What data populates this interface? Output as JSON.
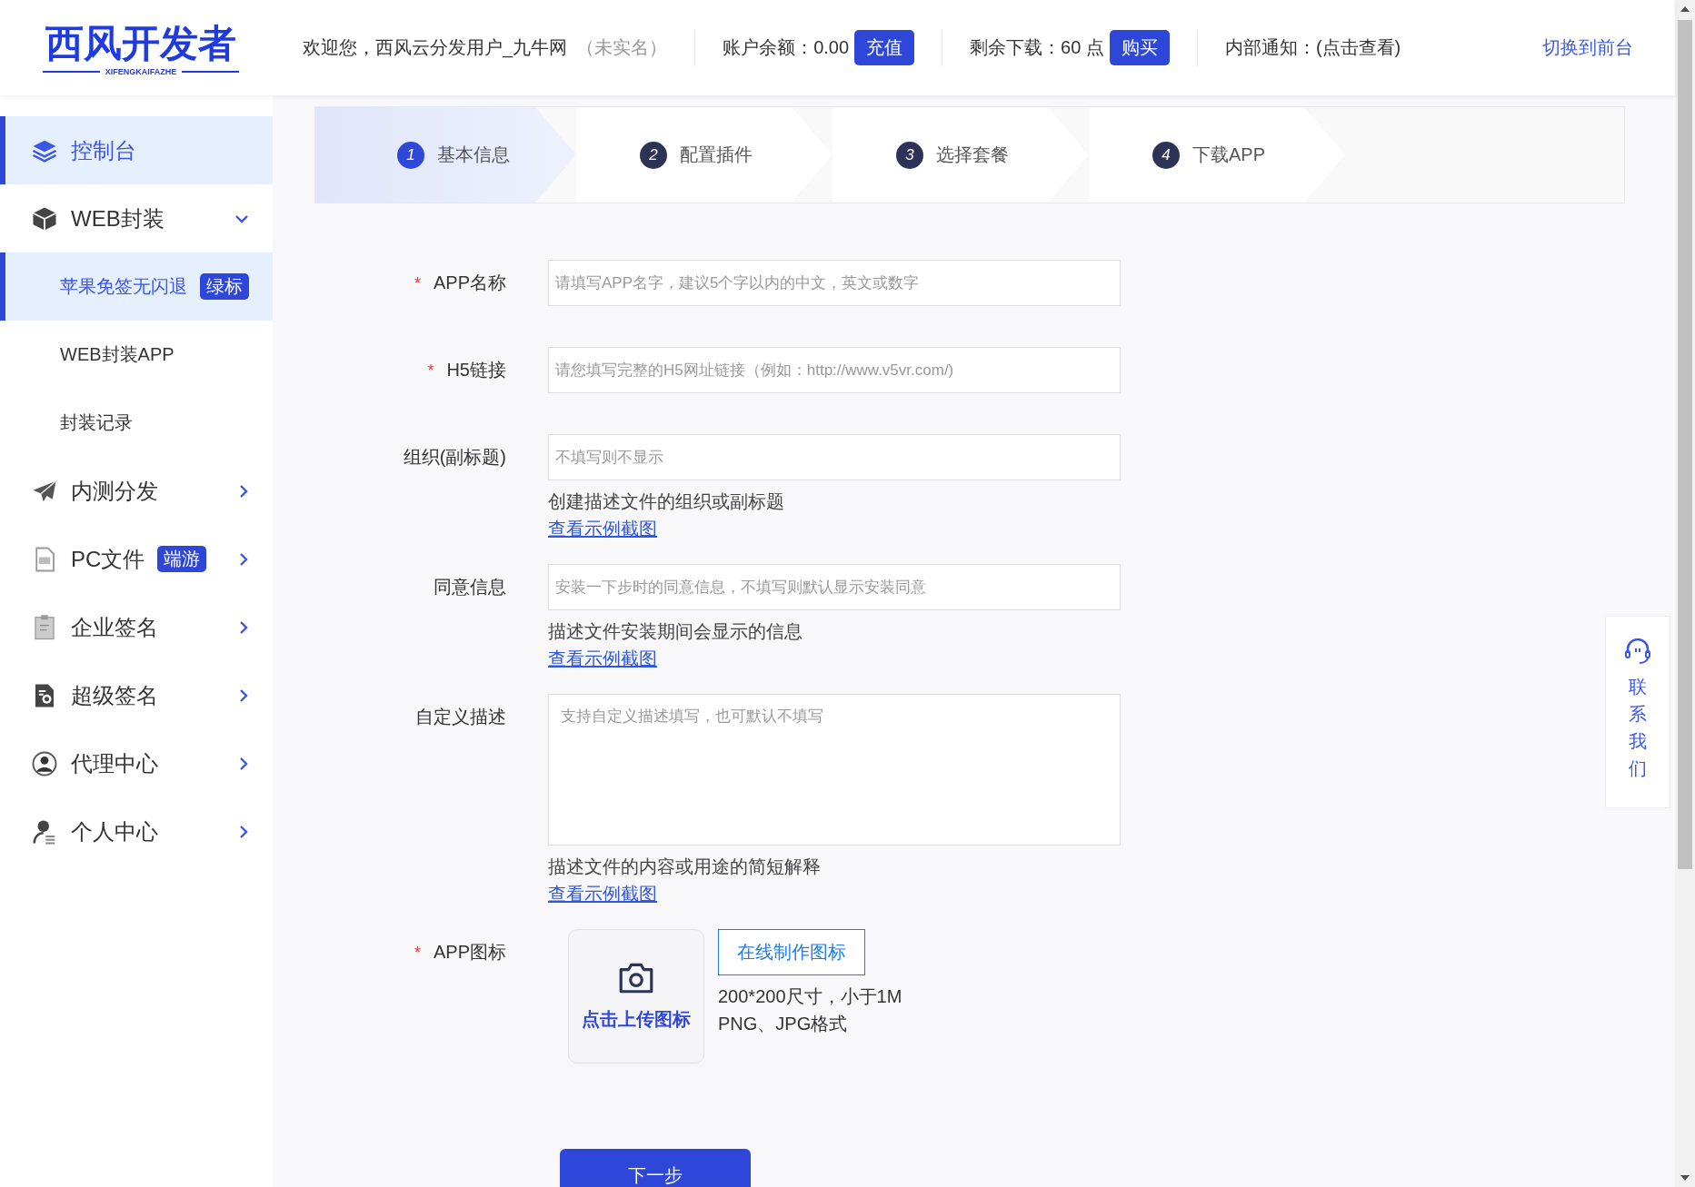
{
  "logo": {
    "title": "西风开发者",
    "subtitle": "XIFENGKAIFAZHE"
  },
  "header": {
    "welcome": "欢迎您，西风云分发用户_九牛网",
    "verify_status": "（未实名）",
    "balance": "账户余额：0.00",
    "recharge_button": "充值",
    "downloads": "剩余下载：60 点",
    "buy_button": "购买",
    "notice": "内部通知：(点击查看)",
    "switch_link": "切换到前台"
  },
  "sidebar": {
    "items": [
      {
        "kind": "link",
        "label": "控制台",
        "selected": true
      },
      {
        "kind": "group",
        "label": "WEB封装",
        "selected": false,
        "expanded": true,
        "children": [
          {
            "label": "苹果免签无闪退",
            "badge": "绿标",
            "selected": true
          },
          {
            "label": "WEB封装APP",
            "selected": false
          },
          {
            "label": "封装记录",
            "selected": false
          }
        ]
      },
      {
        "kind": "group",
        "label": "内测分发",
        "selected": false,
        "expanded": false
      },
      {
        "kind": "group",
        "label": "PC文件",
        "badge": "端游",
        "selected": false,
        "expanded": false
      },
      {
        "kind": "group",
        "label": "企业签名",
        "selected": false,
        "expanded": false
      },
      {
        "kind": "group",
        "label": "超级签名",
        "selected": false,
        "expanded": false
      },
      {
        "kind": "group",
        "label": "代理中心",
        "selected": false,
        "expanded": false
      },
      {
        "kind": "group",
        "label": "个人中心",
        "selected": false,
        "expanded": false
      }
    ]
  },
  "steps": [
    {
      "number": "1",
      "label": "基本信息",
      "selected": true
    },
    {
      "number": "2",
      "label": "配置插件",
      "selected": false
    },
    {
      "number": "3",
      "label": "选择套餐",
      "selected": false
    },
    {
      "number": "4",
      "label": "下载APP",
      "selected": false
    }
  ],
  "form": {
    "fields": [
      {
        "kind": "input",
        "marker": "*",
        "label": "APP名称",
        "placeholder": "请填写APP名字，建议5个字以内的中文，英文或数字"
      },
      {
        "kind": "input",
        "marker": "*",
        "label": "H5链接",
        "placeholder": "请您填写完整的H5网址链接（例如：http://www.v5vr.com/)"
      },
      {
        "kind": "input",
        "label": "组织(副标题)",
        "placeholder": "不填写则不显示",
        "hint": "创建描述文件的组织或副标题",
        "link": "查看示例截图"
      },
      {
        "kind": "input",
        "label": "同意信息",
        "placeholder": "安装一下步时的同意信息，不填写则默认显示安装同意",
        "hint": "描述文件安装期间会显示的信息",
        "link": "查看示例截图"
      },
      {
        "kind": "textarea",
        "label": "自定义描述",
        "placeholder": "支持自定义描述填写，也可默认不填写",
        "hint": "描述文件的内容或用途的简短解释",
        "link": "查看示例截图"
      },
      {
        "kind": "upload",
        "marker": "*",
        "label": "APP图标",
        "upload_label": "点击上传图标",
        "button": "在线制作图标",
        "notes": [
          "200*200尺寸，小于1M",
          "PNG、JPG格式"
        ]
      }
    ],
    "submit_button": "下一步"
  },
  "contact": {
    "label": "联系我们"
  }
}
